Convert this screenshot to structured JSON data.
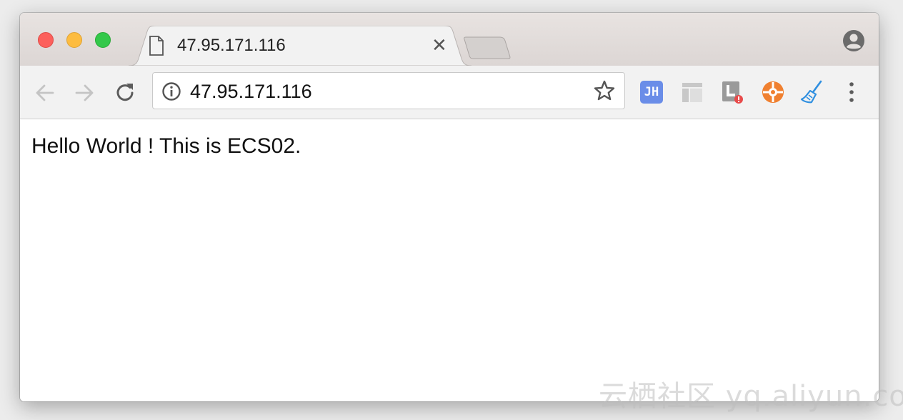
{
  "tab": {
    "title": "47.95.171.116",
    "close_glyph": "✕"
  },
  "omnibox": {
    "url": "47.95.171.116"
  },
  "page": {
    "text": "Hello World ! This is ECS02."
  },
  "extensions": {
    "jh_label": "JH"
  },
  "watermark": {
    "text": "云栖社区 yq.aliyun.com"
  },
  "colors": {
    "close": "#fc605c",
    "minimize": "#fdbc40",
    "maximize": "#34c84a",
    "jh_ext": "#6a8de8",
    "orange_ext": "#f08030",
    "broom_ext": "#2f8fe0"
  }
}
